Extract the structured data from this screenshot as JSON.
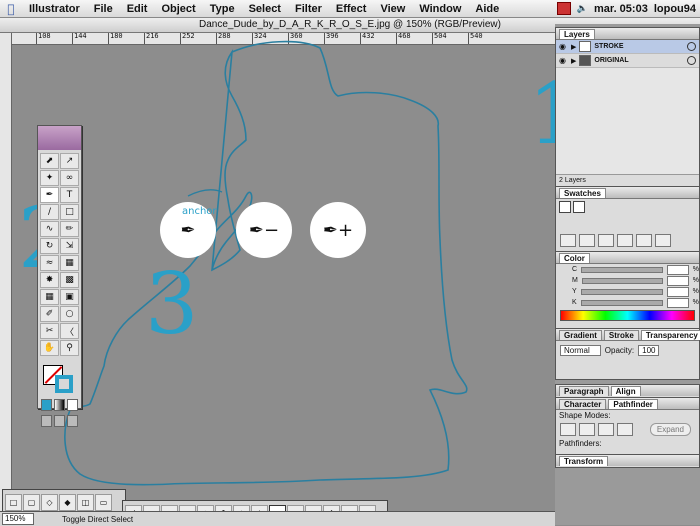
{
  "menubar": {
    "app_name": "Illustrator",
    "items": [
      "File",
      "Edit",
      "Object",
      "Type",
      "Select",
      "Filter",
      "Effect",
      "View",
      "Window",
      "Aide"
    ],
    "clock": "mar. 05:03",
    "user": "lopou94"
  },
  "window": {
    "title": "Dance_Dude_by_D_A_R_K_R_O_S_E.jpg @ 150% (RGB/Preview)"
  },
  "ruler": {
    "ticks": [
      "108",
      "144",
      "180",
      "216",
      "252",
      "288",
      "324",
      "360",
      "396",
      "432",
      "468",
      "504",
      "540"
    ]
  },
  "annotations": {
    "n1": "1",
    "n2": "2",
    "n3": "3"
  },
  "pen_circles": {
    "anchor_label": "anchor",
    "pen": "✒",
    "minus": "−",
    "plus": "+"
  },
  "layers_panel": {
    "tab": "Layers",
    "rows": [
      {
        "name": "STROKE",
        "selected": true
      },
      {
        "name": "ORIGINAL",
        "selected": false
      }
    ],
    "footer": "2 Layers"
  },
  "swatches_panel": {
    "tab": "Swatches"
  },
  "color_panel": {
    "tab": "Color",
    "channels": [
      "C",
      "M",
      "Y",
      "K"
    ],
    "percent": "%"
  },
  "gradient_panel": {
    "tabs": [
      "Gradient",
      "Stroke",
      "Transparency"
    ],
    "blend_mode": "Normal",
    "opacity_label": "Opacity:",
    "opacity_value": "100"
  },
  "paragraph_panel": {
    "tabs": [
      "Paragraph",
      "Align"
    ]
  },
  "character_panel": {
    "tabs": [
      "Character",
      "Pathfinder"
    ],
    "shape_modes": "Shape Modes:",
    "pathfinders": "Pathfinders:",
    "expand": "Expand"
  },
  "transform_panel": {
    "tab": "Transform"
  },
  "statusbar": {
    "zoom": "150%",
    "status": "Toggle Direct Select"
  },
  "colors": {
    "accent": "#2aa0c8",
    "canvas": "#8d8d8d"
  }
}
